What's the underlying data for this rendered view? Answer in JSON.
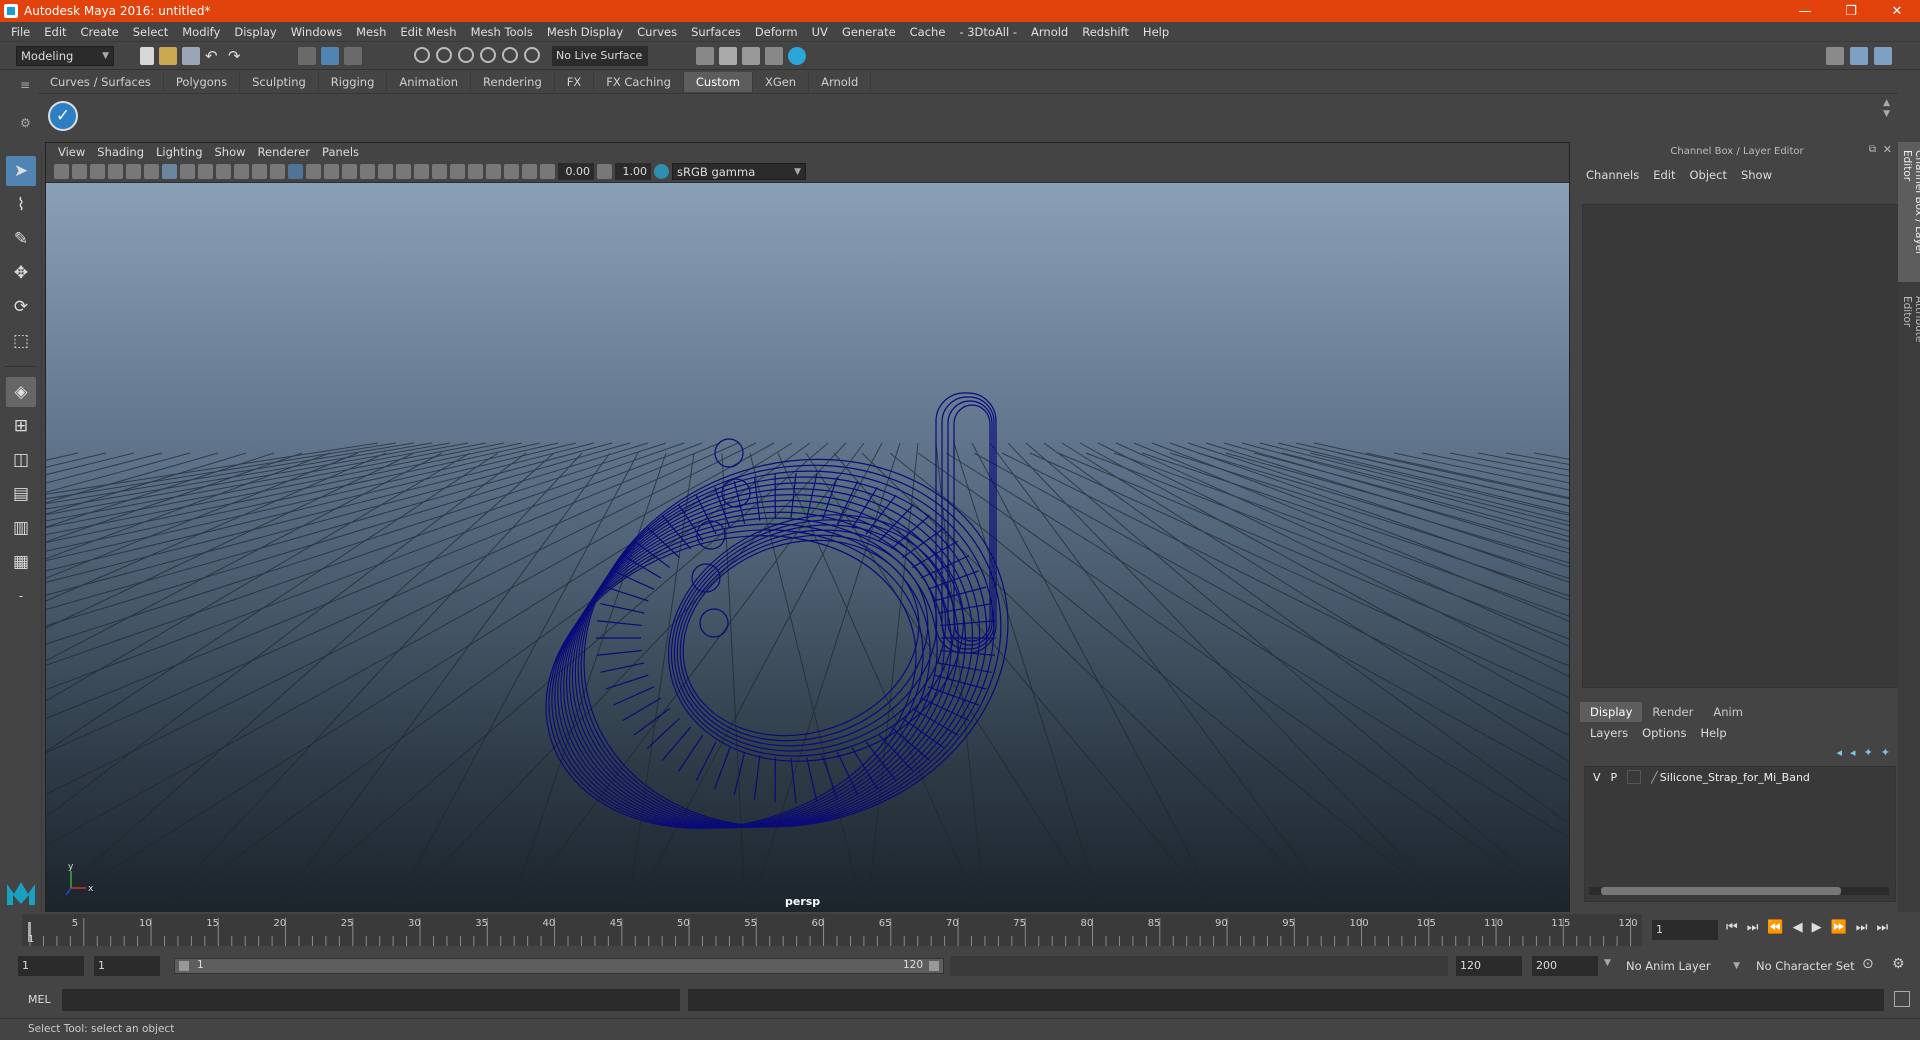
{
  "title": "Autodesk Maya 2016: untitled*",
  "window_controls": {
    "minimize": "—",
    "restore": "❐",
    "close": "✕"
  },
  "menus": [
    "File",
    "Edit",
    "Create",
    "Select",
    "Modify",
    "Display",
    "Windows",
    "Mesh",
    "Edit Mesh",
    "Mesh Tools",
    "Mesh Display",
    "Curves",
    "Surfaces",
    "Deform",
    "UV",
    "Generate",
    "Cache",
    "- 3DtoAll -",
    "Arnold",
    "Redshift",
    "Help"
  ],
  "status_line": {
    "mode": "Modeling",
    "live_surface": "No Live Surface"
  },
  "shelf_tabs": [
    "Curves / Surfaces",
    "Polygons",
    "Sculpting",
    "Rigging",
    "Animation",
    "Rendering",
    "FX",
    "FX Caching",
    "Custom",
    "XGen",
    "Arnold"
  ],
  "active_shelf_tab": "Custom",
  "viewport": {
    "menus": [
      "View",
      "Shading",
      "Lighting",
      "Show",
      "Renderer",
      "Panels"
    ],
    "exposure": "0.00",
    "gamma": "1.00",
    "color_space": "sRGB gamma",
    "camera_label": "persp",
    "axis_x": "x",
    "axis_y": "y"
  },
  "channel_box": {
    "title": "Channel Box / Layer Editor",
    "menus": [
      "Channels",
      "Edit",
      "Object",
      "Show"
    ]
  },
  "layer_editor": {
    "tabs": [
      "Display",
      "Render",
      "Anim"
    ],
    "active_tab": "Display",
    "menus": [
      "Layers",
      "Options",
      "Help"
    ],
    "layers": [
      {
        "v": "V",
        "p": "P",
        "name": "Silicone_Strap_for_Mi_Band"
      }
    ]
  },
  "side_tabs": [
    "Channel Box / Layer Editor",
    "Attribute Editor"
  ],
  "time_slider": {
    "ticks": [
      "5",
      "10",
      "15",
      "20",
      "25",
      "30",
      "35",
      "40",
      "45",
      "50",
      "55",
      "60",
      "65",
      "70",
      "75",
      "80",
      "85",
      "90",
      "95",
      "100",
      "105",
      "110",
      "115",
      "120"
    ],
    "first_tick": "1",
    "current_frame": "1"
  },
  "range_slider": {
    "start": "1",
    "playback_start": "1",
    "bar_start": "1",
    "bar_end": "120",
    "playback_end": "120",
    "end": "200",
    "anim_layer": "No Anim Layer",
    "character_set": "No Character Set"
  },
  "command_line": {
    "label": "MEL"
  },
  "help_line": "Select Tool: select an object",
  "colors": {
    "titlebar": "#e2420c",
    "wireframe": "#0a0a7a",
    "selected_tool": "#5284b3"
  }
}
